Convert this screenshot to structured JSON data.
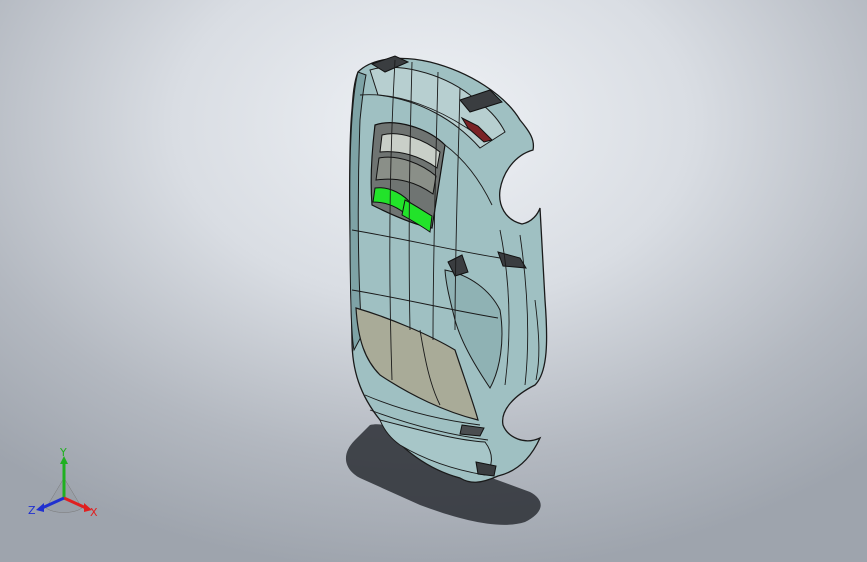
{
  "viewport": {
    "background_top": "#eef1f5",
    "background_bottom": "#9ea4ad"
  },
  "model": {
    "body_color": "#9fc0c2",
    "body_dark": "#6f9498",
    "edge_color": "#1a1a1a",
    "selected_face_color": "#22e32a",
    "roof_panel_color": "#a9ab98",
    "shadow_color": "#2c2f35"
  },
  "triad": {
    "x_label": "X",
    "y_label": "Y",
    "z_label": "Z",
    "x_color": "#e02020",
    "y_color": "#20b020",
    "z_color": "#2030d0"
  }
}
